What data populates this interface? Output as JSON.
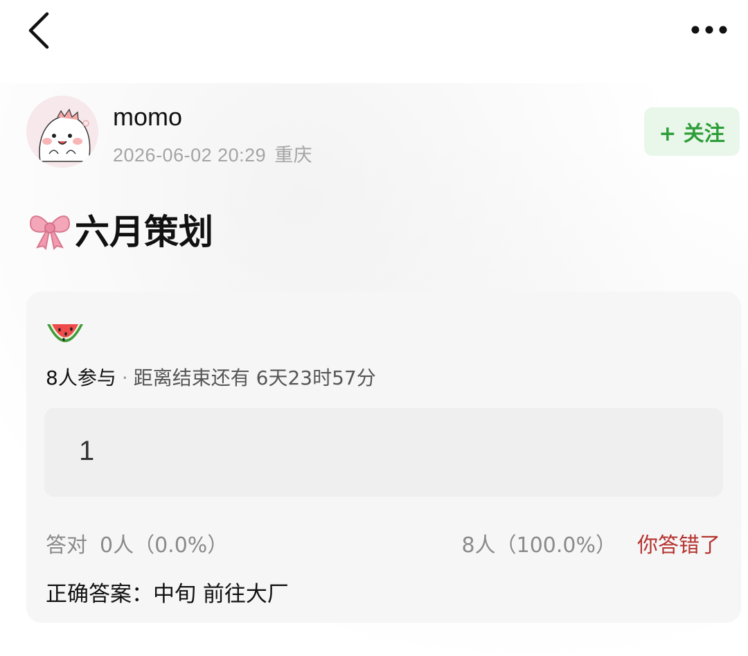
{
  "topbar": {
    "back_icon": "chevron-left-icon",
    "more_icon": "more-horizontal-icon"
  },
  "author": {
    "name": "momo",
    "datetime": "2026-06-02 20:29",
    "location": "重庆",
    "follow_label": "+ 关注",
    "follow_color": "#2e9d3a"
  },
  "post": {
    "title_icon": "ribbon-bow-icon",
    "title": "六月策划"
  },
  "quiz": {
    "icon": "watermelon-icon",
    "participants": "8人参与",
    "separator": "·",
    "countdown": "距离结束还有 6天23时57分",
    "option_text": "1",
    "correct_label": "答对",
    "correct_stat": "0人（0.0%）",
    "wrong_stat": "8人（100.0%）",
    "result_text": "你答错了",
    "result_color": "#b5322e",
    "answer": "正确答案：中旬 前往大厂"
  }
}
